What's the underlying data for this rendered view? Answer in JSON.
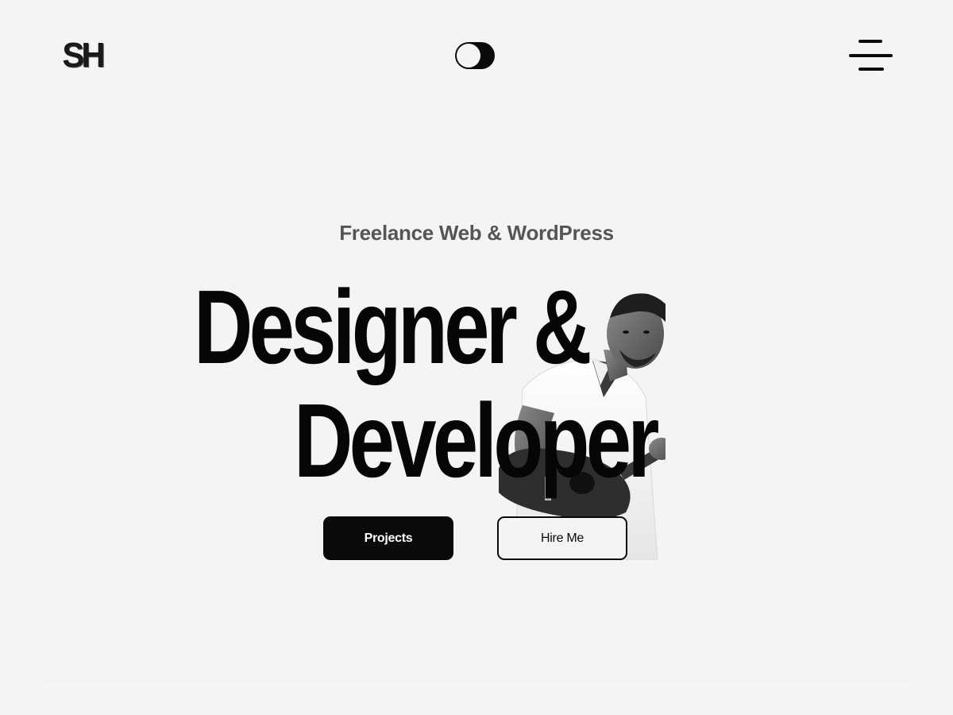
{
  "header": {
    "logo_text": "SH",
    "theme_toggle_state": "dark",
    "menu_icon": "hamburger-icon"
  },
  "hero": {
    "subtitle": "Freelance Web & WordPress",
    "headline_line1": "Designer &",
    "headline_line2": "Developer",
    "photo_description_icon": "person-with-guitar"
  },
  "buttons": {
    "projects_label": "Projects",
    "hire_label": "Hire Me"
  },
  "colors": {
    "background": "#f4f4f4",
    "accent": "#0a0a0a",
    "subtitle": "#555555"
  }
}
